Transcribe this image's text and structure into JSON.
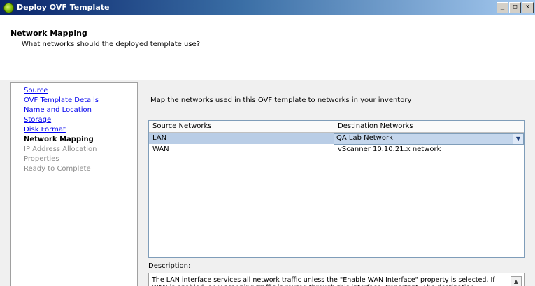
{
  "window": {
    "title": "Deploy OVF Template",
    "minimize": "_",
    "maximize": "□",
    "close": "x",
    "icon": "vmware-deploy-icon"
  },
  "header": {
    "title": "Network Mapping",
    "subtitle": "What networks should the deployed template use?"
  },
  "steps": [
    {
      "label": "Source",
      "state": "link"
    },
    {
      "label": "OVF Template Details",
      "state": "link"
    },
    {
      "label": "Name and Location",
      "state": "link"
    },
    {
      "label": "Storage",
      "state": "link"
    },
    {
      "label": "Disk Format",
      "state": "link"
    },
    {
      "label": "Network Mapping",
      "state": "current"
    },
    {
      "label": "IP Address Allocation",
      "state": "pending"
    },
    {
      "label": "Properties",
      "state": "pending"
    },
    {
      "label": "Ready to Complete",
      "state": "pending"
    }
  ],
  "main": {
    "instruction": "Map the networks used in this OVF template to networks in your inventory",
    "table": {
      "headers": [
        "Source Networks",
        "Destination Networks"
      ],
      "rows": [
        {
          "source": "LAN",
          "destination": "QA Lab Network",
          "selected": true
        },
        {
          "source": "WAN",
          "destination": "vScanner 10.10.21.x network",
          "selected": false
        }
      ]
    },
    "description_label": "Description:",
    "description_text": "The LAN interface services all network traffic unless the \"Enable WAN Interface\" property is selected. If WAN is enabled, only scanning traffic is routed through this interface. Important: The destination network must have IP Pools defined in order to power up the virtual scanner."
  },
  "colors": {
    "title_bar_start": "#0a246a",
    "title_bar_end": "#a6caf0",
    "selection": "#b9cde6",
    "link": "#0000ee"
  }
}
